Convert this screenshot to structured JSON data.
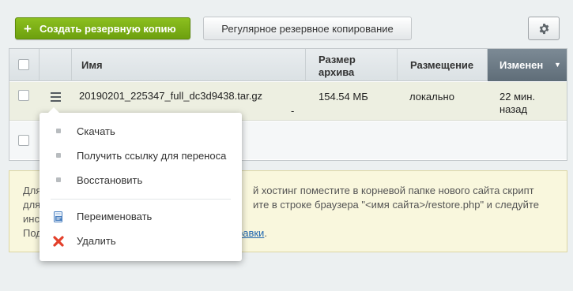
{
  "toolbar": {
    "create_label": "Создать резервную копию",
    "create_icon": "plus-icon",
    "regular_label": "Регулярное резервное копирование",
    "settings_icon": "gear-icon"
  },
  "table": {
    "columns": {
      "name": "Имя",
      "size_line1": "Размер",
      "size_line2": "архива",
      "place": "Размещение",
      "changed": "Изменен",
      "sort_indicator": "▼"
    },
    "rows": [
      {
        "name": "20190201_225347_full_dc3d9438.tar.gz",
        "dash": "-",
        "size": "154.54 МБ",
        "place": "локально",
        "changed_line1": "22 мин.",
        "changed_line2": "назад"
      }
    ]
  },
  "info": {
    "line1_left": "Для",
    "line1_right": "й хостинг поместите в корневой папке нового сайта скрипт",
    "line2_left": "для",
    "line2_right": "ите в строке браузера \"<имя сайта>/restore.php\" и следуйте",
    "line3_left": "инс",
    "line4_left": "Под",
    "link_text": "равки",
    "line4_end": "."
  },
  "context_menu": {
    "items": [
      {
        "label": "Скачать",
        "icon": "bullet-icon"
      },
      {
        "label": "Получить ссылку для переноса",
        "icon": "bullet-icon"
      },
      {
        "label": "Восстановить",
        "icon": "bullet-icon"
      },
      {
        "label": "Переименовать",
        "icon": "rename-icon"
      },
      {
        "label": "Удалить",
        "icon": "delete-icon"
      }
    ]
  },
  "colors": {
    "create_button": "#7bb015",
    "sorted_header": "#6b7984",
    "selected_row": "#edefe1",
    "info_background": "#f9f7dd",
    "link": "#2067b0",
    "delete_icon": "#e3402b"
  }
}
